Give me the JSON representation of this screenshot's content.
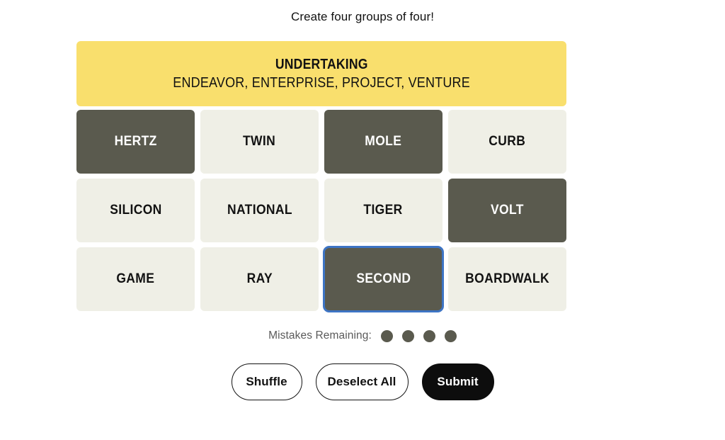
{
  "header": {
    "instruction": "Create four groups of four!"
  },
  "solved_groups": [
    {
      "title": "UNDERTAKING",
      "words": "ENDEAVOR, ENTERPRISE, PROJECT, VENTURE",
      "color": "#f9df6d"
    }
  ],
  "grid": {
    "rows": [
      [
        {
          "label": "HERTZ",
          "state": "selected",
          "focused": false
        },
        {
          "label": "TWIN",
          "state": "unselected",
          "focused": false
        },
        {
          "label": "MOLE",
          "state": "selected",
          "focused": false
        },
        {
          "label": "CURB",
          "state": "unselected",
          "focused": false
        }
      ],
      [
        {
          "label": "SILICON",
          "state": "unselected",
          "focused": false
        },
        {
          "label": "NATIONAL",
          "state": "unselected",
          "focused": false
        },
        {
          "label": "TIGER",
          "state": "unselected",
          "focused": false
        },
        {
          "label": "VOLT",
          "state": "selected",
          "focused": false
        }
      ],
      [
        {
          "label": "GAME",
          "state": "unselected",
          "focused": false
        },
        {
          "label": "RAY",
          "state": "unselected",
          "focused": false
        },
        {
          "label": "SECOND",
          "state": "selected",
          "focused": true
        },
        {
          "label": "BOARDWALK",
          "state": "unselected",
          "focused": false
        }
      ]
    ]
  },
  "mistakes": {
    "label": "Mistakes Remaining:",
    "remaining": 4,
    "dot_color": "#5a5a4e"
  },
  "buttons": {
    "shuffle": "Shuffle",
    "deselect": "Deselect All",
    "submit": "Submit"
  },
  "colors": {
    "tile_unselected": "#efefe6",
    "tile_selected": "#5a5a4e",
    "focus_ring": "#3d74c4",
    "submit_background": "#0d0d0d",
    "text_primary": "#121212",
    "text_muted": "#5a5a5a"
  }
}
